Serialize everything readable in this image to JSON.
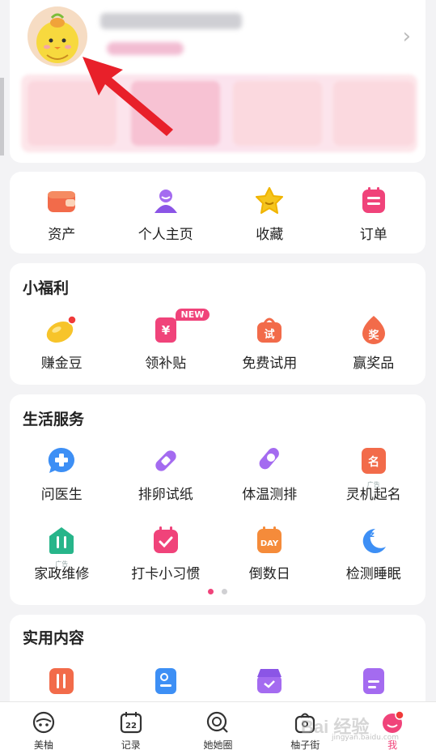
{
  "quick_actions": [
    {
      "label": "资产",
      "icon": "wallet-icon"
    },
    {
      "label": "个人主页",
      "icon": "person-icon"
    },
    {
      "label": "收藏",
      "icon": "star-icon"
    },
    {
      "label": "订单",
      "icon": "order-icon"
    }
  ],
  "welfare": {
    "title": "小福利",
    "items": [
      {
        "label": "赚金豆",
        "icon": "gold-bean-icon"
      },
      {
        "label": "领补贴",
        "icon": "subsidy-icon",
        "badge": "NEW"
      },
      {
        "label": "免费试用",
        "icon": "trial-bag-icon"
      },
      {
        "label": "赢奖品",
        "icon": "prize-icon"
      }
    ]
  },
  "life": {
    "title": "生活服务",
    "ad_tag": "广告",
    "items": [
      {
        "label": "问医生",
        "icon": "doctor-chat-icon"
      },
      {
        "label": "排卵试纸",
        "icon": "ovulation-strip-icon"
      },
      {
        "label": "体温测排",
        "icon": "thermometer-icon"
      },
      {
        "label": "灵机起名",
        "icon": "naming-icon"
      },
      {
        "label": "家政维修",
        "icon": "housekeeping-icon"
      },
      {
        "label": "打卡小习惯",
        "icon": "checkin-icon"
      },
      {
        "label": "倒数日",
        "icon": "countdown-day-icon",
        "icon_text": "DAY"
      },
      {
        "label": "检测睡眠",
        "icon": "sleep-icon"
      }
    ]
  },
  "content": {
    "title": "实用内容"
  },
  "tabs": [
    {
      "label": "美柚",
      "icon": "meiyou-icon"
    },
    {
      "label": "记录",
      "icon": "calendar-icon",
      "icon_text": "22"
    },
    {
      "label": "她她圈",
      "icon": "circle-icon"
    },
    {
      "label": "柚子街",
      "icon": "shop-bag-icon"
    },
    {
      "label": "我",
      "icon": "me-icon",
      "active": true
    }
  ],
  "colors": {
    "accent": "#f0437a",
    "arrow": "#e8202a"
  },
  "watermark": {
    "text": "Bai 经验",
    "sub": "jingyan.baidu.com"
  }
}
